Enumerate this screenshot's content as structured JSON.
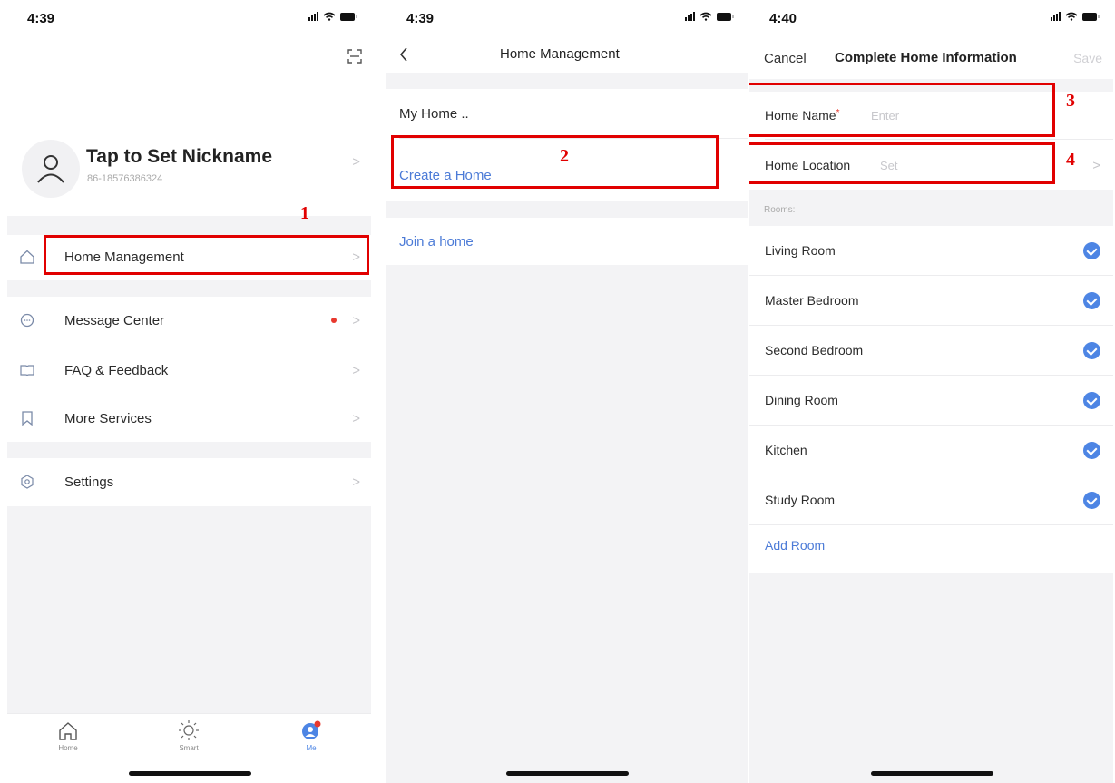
{
  "status": {
    "screen1_time": "4:39",
    "screen2_time": "4:39",
    "screen3_time": "4:40"
  },
  "me": {
    "nickname": "Tap to Set Nickname",
    "phone": "86-18576386324",
    "menu": [
      {
        "label": "Home Management",
        "icon": "home-icon"
      },
      {
        "label": "Message Center",
        "icon": "message-icon"
      },
      {
        "label": "FAQ & Feedback",
        "icon": "faq-icon"
      },
      {
        "label": "More Services",
        "icon": "bookmark-icon"
      },
      {
        "label": "Settings",
        "icon": "settings-icon"
      }
    ],
    "tabs": [
      {
        "label": "Home",
        "icon": "home-tab-icon"
      },
      {
        "label": "Smart",
        "icon": "sun-icon"
      },
      {
        "label": "Me",
        "icon": "user-icon"
      }
    ]
  },
  "home_management": {
    "title": "Home Management",
    "homes": [
      "My Home .."
    ],
    "create_label": "Create a Home",
    "join_label": "Join a home"
  },
  "complete_info": {
    "cancel_label": "Cancel",
    "title": "Complete Home Information",
    "save_label": "Save",
    "home_name_label": "Home Name",
    "home_name_placeholder": "Enter",
    "location_label": "Home Location",
    "location_placeholder": "Set",
    "rooms_header": "Rooms:",
    "rooms": [
      "Living Room",
      "Master Bedroom",
      "Second Bedroom",
      "Dining Room",
      "Kitchen",
      "Study Room"
    ],
    "add_room_label": "Add Room"
  },
  "annotations": [
    "1",
    "2",
    "3",
    "4"
  ],
  "colors": {
    "accent": "#4c7bd7",
    "check": "#4d85e4",
    "annotation": "#e10000",
    "notification_dot": "#e8382e"
  }
}
